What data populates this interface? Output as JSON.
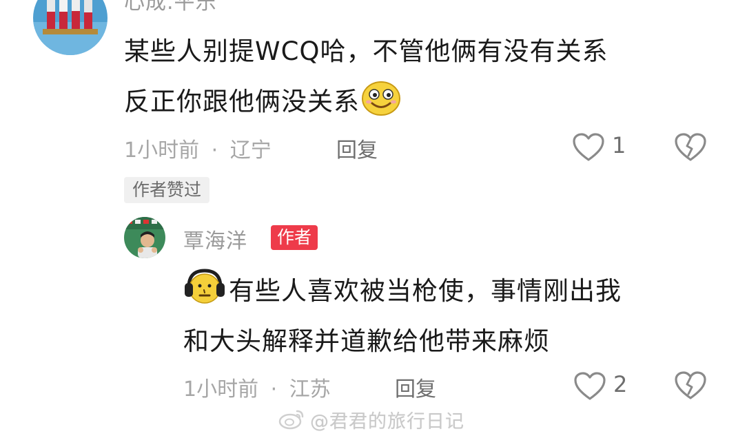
{
  "comments": [
    {
      "username": "心成.平乐",
      "text_line1": "某些人别提WCQ哈，不管他俩有没有关系",
      "text_line2": "反正你跟他俩没关系",
      "emoji": "smile-emoji",
      "time": "1小时前",
      "location": "辽宁",
      "separator": "·",
      "reply_label": "回复",
      "like_count": "1",
      "author_liked_tag": "作者赞过"
    },
    {
      "username": "覃海洋",
      "author_badge": "作者",
      "emoji": "headphones-emoji",
      "text_line1": "有些人喜欢被当枪使，事情刚出我",
      "text_line2": "和大头解释并道歉给他带来麻烦",
      "time": "1小时前",
      "location": "江苏",
      "separator": "·",
      "reply_label": "回复",
      "like_count": "2"
    }
  ],
  "watermark": "@君君的旅行日记",
  "colors": {
    "badge_red": "#ee3b4a",
    "meta_gray": "#a6a6a6",
    "text_dark": "#1a1a1a"
  }
}
